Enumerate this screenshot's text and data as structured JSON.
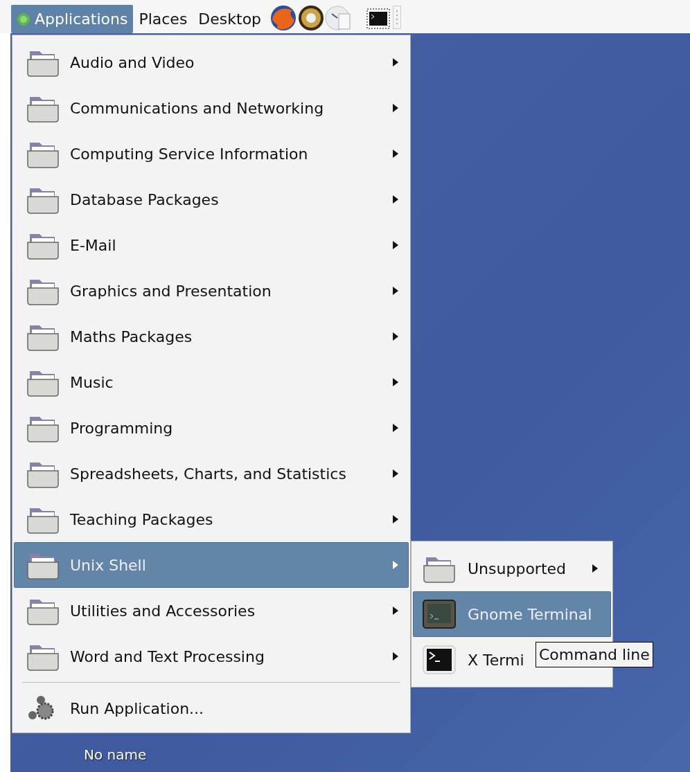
{
  "panel": {
    "menus": [
      {
        "label": "Applications",
        "selected": true
      },
      {
        "label": "Places",
        "selected": false
      },
      {
        "label": "Desktop",
        "selected": false
      }
    ]
  },
  "menu": {
    "items": [
      {
        "kind": "folder",
        "label": "Audio and Video",
        "selected": false
      },
      {
        "kind": "folder",
        "label": "Communications and Networking",
        "selected": false
      },
      {
        "kind": "folder",
        "label": "Computing Service Information",
        "selected": false
      },
      {
        "kind": "folder",
        "label": "Database Packages",
        "selected": false
      },
      {
        "kind": "folder",
        "label": "E-Mail",
        "selected": false
      },
      {
        "kind": "folder",
        "label": "Graphics and Presentation",
        "selected": false
      },
      {
        "kind": "folder",
        "label": "Maths Packages",
        "selected": false
      },
      {
        "kind": "folder",
        "label": "Music",
        "selected": false
      },
      {
        "kind": "folder",
        "label": "Programming",
        "selected": false
      },
      {
        "kind": "folder",
        "label": "Spreadsheets, Charts, and Statistics",
        "selected": false
      },
      {
        "kind": "folder",
        "label": "Teaching Packages",
        "selected": false
      },
      {
        "kind": "folder",
        "label": "Unix Shell",
        "selected": true
      },
      {
        "kind": "folder",
        "label": "Utilities and Accessories",
        "selected": false
      },
      {
        "kind": "folder",
        "label": "Word and Text Processing",
        "selected": false
      },
      {
        "kind": "separator"
      },
      {
        "kind": "run",
        "label": "Run Application...",
        "selected": false
      }
    ]
  },
  "submenu": {
    "items": [
      {
        "kind": "folder",
        "label": "Unsupported",
        "selected": false
      },
      {
        "kind": "gnome-terminal",
        "label": "Gnome Terminal",
        "selected": true
      },
      {
        "kind": "x-terminal",
        "label": "X Termi",
        "selected": false
      }
    ]
  },
  "tooltip": {
    "text": "Command line"
  },
  "desktop": {
    "icon_label": "No name"
  }
}
